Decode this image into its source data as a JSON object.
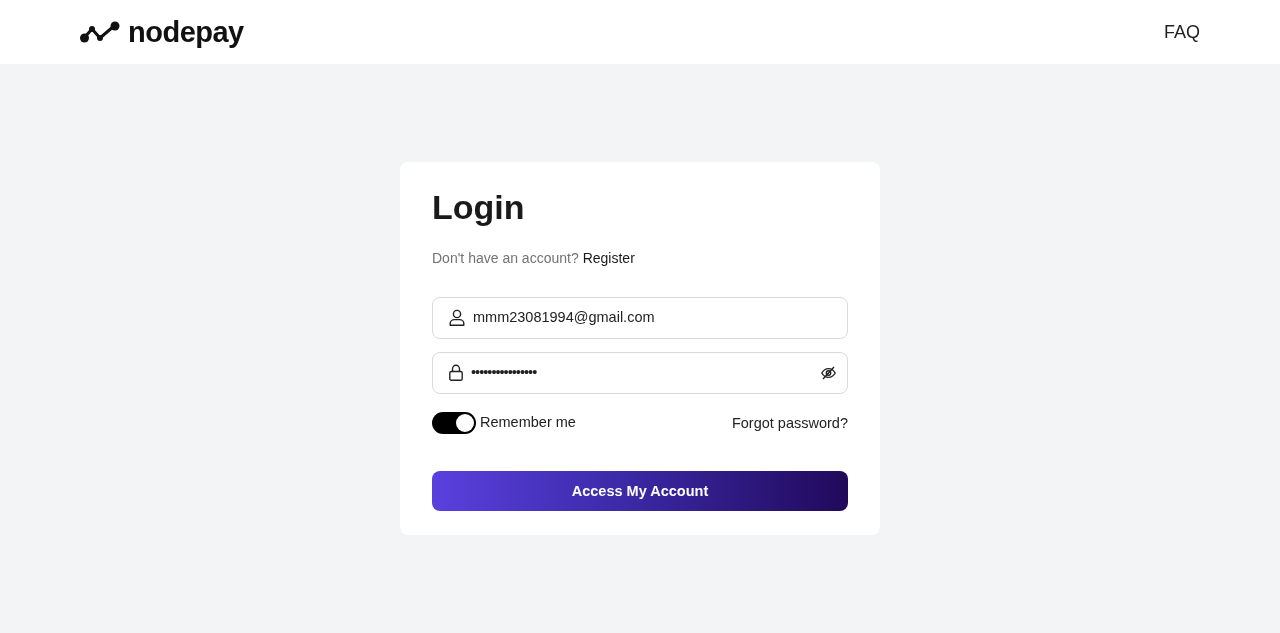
{
  "header": {
    "logo": {
      "text": "nodepay"
    },
    "nav": [
      {
        "label": "FAQ"
      }
    ]
  },
  "login": {
    "title": "Login",
    "prompt": "Don't have an account?",
    "register_link": "Register",
    "fields": [
      {
        "kind": "email",
        "value": "mmm23081994@gmail.com"
      },
      {
        "kind": "password",
        "value": "••••••••••••••••"
      }
    ],
    "remember": {
      "label": "Remember me",
      "on": true
    },
    "forgot_link": "Forgot password?",
    "submit": "Access My Account"
  }
}
